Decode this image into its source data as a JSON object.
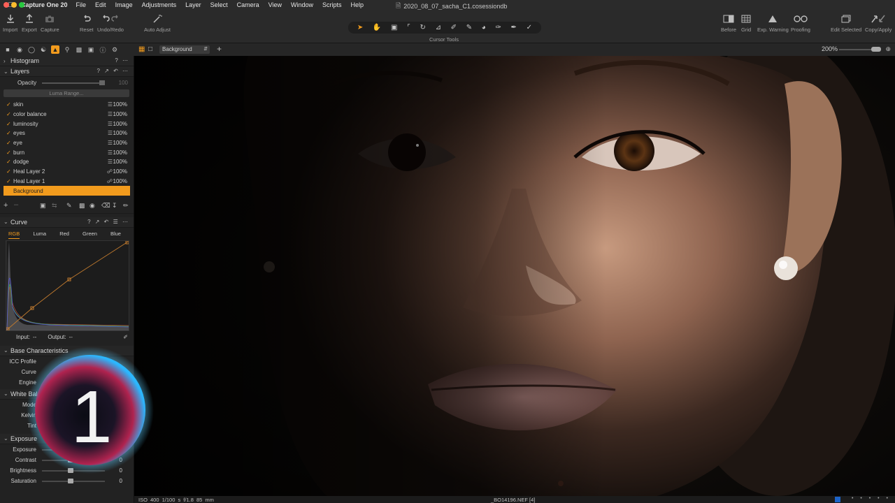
{
  "menubar": {
    "app_name": "Capture One 20",
    "items": [
      "File",
      "Edit",
      "Image",
      "Adjustments",
      "Layer",
      "Select",
      "Camera",
      "View",
      "Window",
      "Scripts",
      "Help"
    ],
    "document_title": "2020_08_07_sacha_C1.cosessiondb"
  },
  "toolbar": {
    "left": [
      {
        "label": "Import",
        "icon": "import-icon"
      },
      {
        "label": "Export",
        "icon": "export-icon"
      },
      {
        "label": "Capture",
        "icon": "camera-icon"
      },
      {
        "label": "Reset",
        "icon": "reset-icon"
      },
      {
        "label": "Undo/Redo",
        "icon": "undo-redo-icon"
      },
      {
        "label": "Auto Adjust",
        "icon": "magic-wand-icon"
      }
    ],
    "cursor_tools_label": "Cursor Tools",
    "right": [
      {
        "label": "Before",
        "icon": "before-icon"
      },
      {
        "label": "Grid",
        "icon": "grid-icon"
      },
      {
        "label": "Exp. Warning",
        "icon": "warning-icon"
      },
      {
        "label": "Proofing",
        "icon": "glasses-icon"
      },
      {
        "label": "Edit Selected",
        "icon": "edit-selected-icon"
      },
      {
        "label": "Copy/Apply",
        "icon": "copy-apply-icon"
      }
    ]
  },
  "viewer_bar": {
    "layer_select": "Background",
    "zoom": "200%"
  },
  "histogram": {
    "title": "Histogram"
  },
  "layers": {
    "title": "Layers",
    "opacity_label": "Opacity",
    "opacity_value": "100",
    "luma_range_label": "Luma Range...",
    "items": [
      {
        "name": "skin",
        "opacity": "100%",
        "icon": "sliders-icon"
      },
      {
        "name": "color balance",
        "opacity": "100%",
        "icon": "sliders-icon"
      },
      {
        "name": "luminosity",
        "opacity": "100%",
        "icon": "sliders-icon"
      },
      {
        "name": "eyes",
        "opacity": "100%",
        "icon": "sliders-icon"
      },
      {
        "name": "eye",
        "opacity": "100%",
        "icon": "sliders-icon"
      },
      {
        "name": "burn",
        "opacity": "100%",
        "icon": "sliders-icon"
      },
      {
        "name": "dodge",
        "opacity": "100%",
        "icon": "sliders-icon"
      },
      {
        "name": "Heal Layer 2",
        "opacity": "100%",
        "icon": "heal-icon"
      },
      {
        "name": "Heal Layer 1",
        "opacity": "100%",
        "icon": "heal-icon"
      }
    ],
    "background": "Background"
  },
  "curve": {
    "title": "Curve",
    "tabs": [
      "RGB",
      "Luma",
      "Red",
      "Green",
      "Blue"
    ],
    "input_label": "Input:",
    "input_value": "--",
    "output_label": "Output:",
    "output_value": "--"
  },
  "base_characteristics": {
    "title": "Base Characteristics",
    "icc_label": "ICC Profile",
    "curve_label": "Curve",
    "engine_label": "Engine"
  },
  "white_balance": {
    "title": "White Balance",
    "mode_label": "Mode",
    "kelvin_label": "Kelvin",
    "tint_label": "Tint"
  },
  "exposure": {
    "title": "Exposure",
    "rows": [
      {
        "label": "Exposure",
        "value": "0"
      },
      {
        "label": "Contrast",
        "value": "0"
      },
      {
        "label": "Brightness",
        "value": "0"
      },
      {
        "label": "Saturation",
        "value": "0"
      }
    ]
  },
  "status": {
    "meta": "ISO 400   1/100 s   f/1.8   85 mm",
    "filename": "_BO14196.NEF [4]"
  },
  "logo_text": "1"
}
